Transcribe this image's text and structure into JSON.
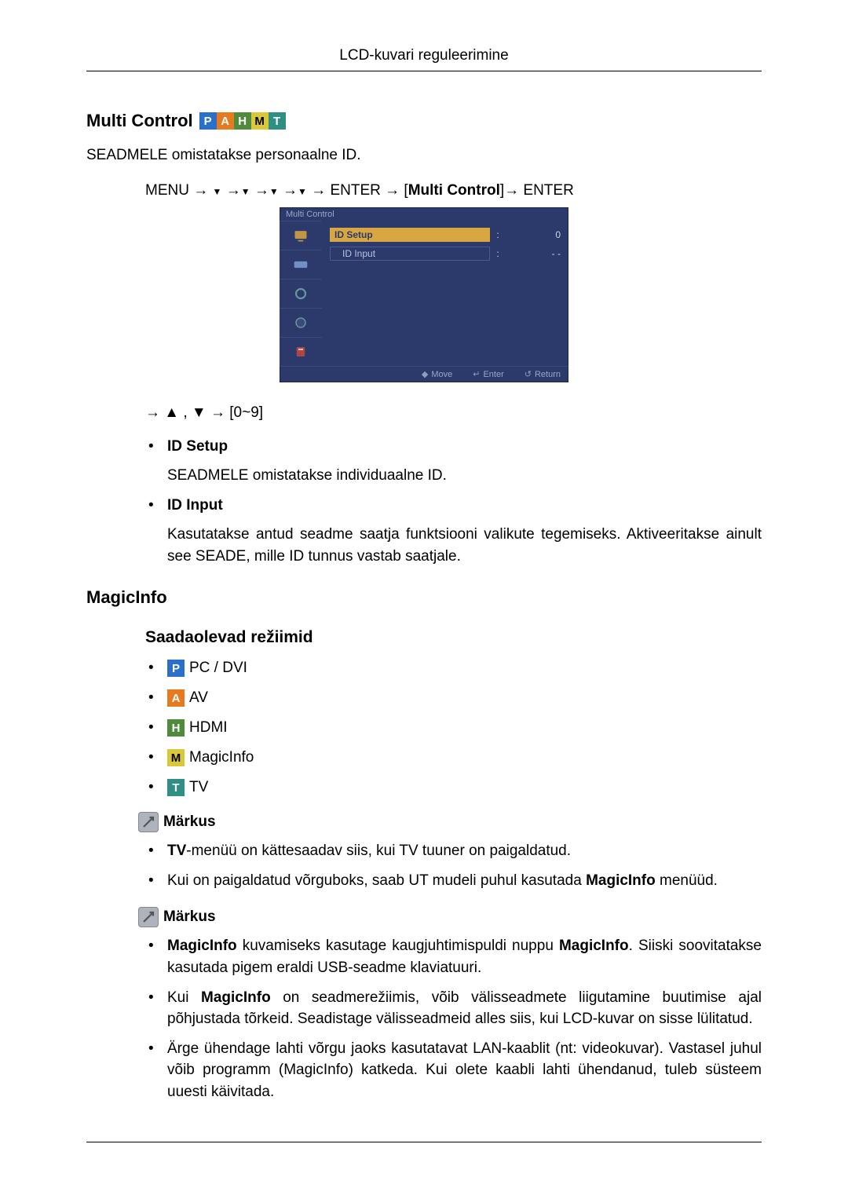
{
  "header": {
    "title": "LCD-kuvari reguleerimine"
  },
  "multi_control": {
    "title": "Multi Control",
    "intro": "SEADMELE omistatakse personaalne ID.",
    "path_prefix": "MENU →",
    "path_enter1": "→ ENTER → [",
    "path_label": "Multi Control",
    "path_enter2": "]→ ENTER",
    "osd": {
      "title": "Multi Control",
      "row_id_setup": "ID  Setup",
      "row_id_setup_val": "0",
      "row_id_input": "ID  Input",
      "row_id_input_val": "- -",
      "footer_move": "Move",
      "footer_enter": "Enter",
      "footer_return": "Return"
    },
    "nav_range": "→ ▲ , ▼ → [0~9]",
    "items": [
      {
        "title": "ID Setup",
        "desc": "SEADMELE omistatakse individuaalne ID."
      },
      {
        "title": "ID Input",
        "desc": "Kasutatakse antud seadme saatja funktsiooni valikute tegemiseks. Aktiveeritakse ainult see SEADE, mille ID tunnus vastab saatjale."
      }
    ]
  },
  "magicinfo": {
    "title": "MagicInfo",
    "modes_title": "Saadaolevad režiimid",
    "modes": [
      {
        "badge": "P",
        "label": "PC / DVI"
      },
      {
        "badge": "A",
        "label": "AV"
      },
      {
        "badge": "H",
        "label": "HDMI"
      },
      {
        "badge": "M",
        "label": "MagicInfo"
      },
      {
        "badge": "T",
        "label": "TV"
      }
    ],
    "note_label": "Märkus",
    "notes1": [
      {
        "pre_bold": "TV",
        "rest": "-menüü on kättesaadav siis, kui TV tuuner on paigaldatud."
      },
      {
        "plain_pre": "Kui on paigaldatud võrguboks, saab UT mudeli puhul kasutada ",
        "mid_bold": "MagicInfo",
        "plain_post": " menüüd."
      }
    ],
    "notes2": [
      {
        "pre_bold": "MagicInfo",
        "mid": " kuvamiseks kasutage kaugjuhtimispuldi nuppu ",
        "mid_bold": "MagicInfo",
        "post": ". Siiski soovitatakse kasutada pigem eraldi USB-seadme klaviatuuri."
      },
      {
        "plain_pre": "Kui ",
        "pre_bold": "MagicInfo",
        "post": " on seadmerežiimis, võib välisseadmete liigutamine buutimise ajal põhjustada tõrkeid. Seadistage välisseadmeid alles siis, kui LCD-kuvar on sisse lülitatud."
      },
      {
        "plain": "Ärge ühendage lahti võrgu jaoks kasutatavat LAN-kaablit (nt: videokuvar). Vastasel juhul võib programm (MagicInfo) katkeda. Kui olete kaabli lahti ühendanud, tuleb süsteem uuesti käivitada."
      }
    ]
  }
}
